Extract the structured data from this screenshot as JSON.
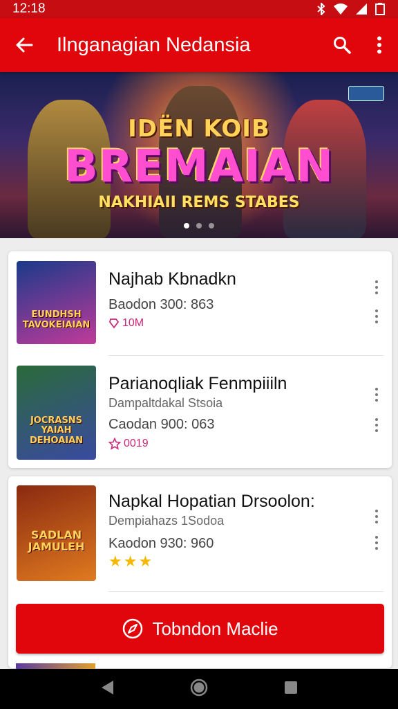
{
  "status_bar": {
    "time": "12:18"
  },
  "app_bar": {
    "title": "Ilnganagian Nedansia"
  },
  "banner": {
    "line1": "IDËN        KOIB",
    "title": "BREMAIAN",
    "subtitle": "NAKHIAII REMS STABES",
    "badge": "",
    "carousel_count": 3,
    "active_index": 0
  },
  "items": [
    {
      "title": "Najhab Kbnadkn",
      "subtitle": "",
      "meta": "Baodon 300: 863",
      "tag": "10M",
      "tag_icon": "tag-icon",
      "thumb_text": "EUNDHSH TAVOKEIAIAN",
      "thumb_colors": [
        "#1a3a8a",
        "#c03a9a"
      ]
    },
    {
      "title": "Parianoqliak Fenmpiiiln",
      "subtitle": "Dampaltdakal Stsoia",
      "meta": "Caodan 900: 063",
      "tag": "0019",
      "tag_icon": "star-outline-icon",
      "thumb_text": "JOCRASNS YAIAH DEHOAIAN",
      "thumb_colors": [
        "#2a6a3a",
        "#3a4aa0"
      ]
    },
    {
      "title": "Napkal Hopatian Drsoolon:",
      "subtitle": "Dempiahazs 1Sodoa",
      "meta": "Kaodon 930: 960",
      "rating": "★★★",
      "thumb_text": "SADLAN JAMULEH",
      "thumb_colors": [
        "#8a2a10",
        "#e07a20"
      ]
    }
  ],
  "cta": {
    "label": "Tobndon Maclie"
  },
  "colors": {
    "primary": "#e0060c",
    "status": "#c50d12",
    "tag": "#c8287a",
    "star": "#f5b800"
  }
}
